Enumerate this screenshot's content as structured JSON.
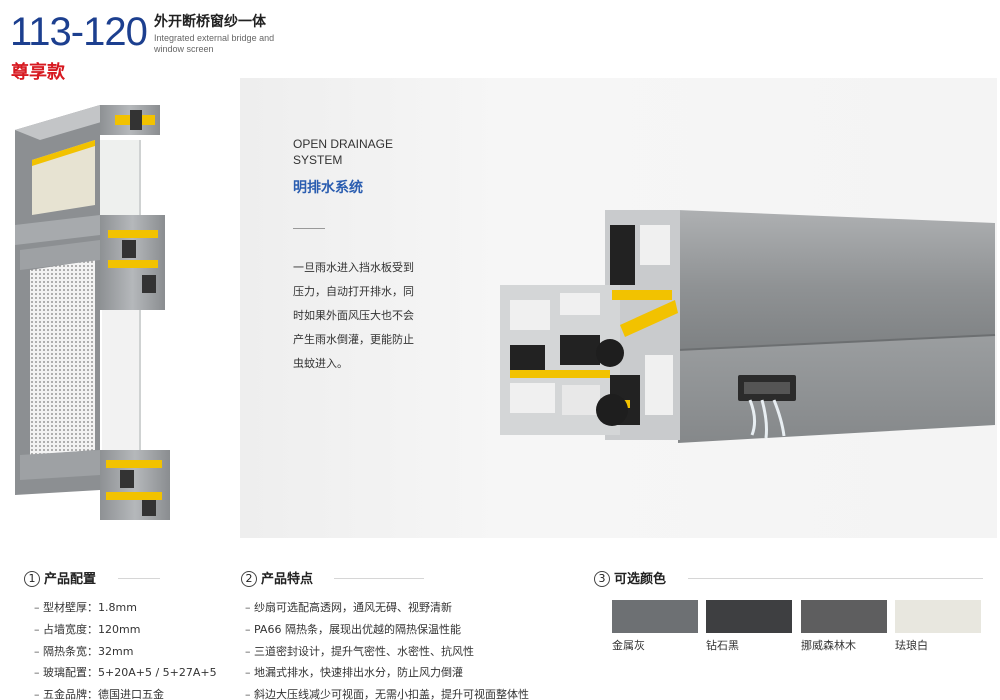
{
  "header": {
    "model": "113-120",
    "title_cn": "外开断桥窗纱一体",
    "title_en": "Integrated external bridge and window screen",
    "edition": "尊享款"
  },
  "feature": {
    "title_en_line1": "OPEN DRAINAGE",
    "title_en_line2": "SYSTEM",
    "title_cn": "明排水系统",
    "desc_lines": [
      "一旦雨水进入挡水板受到",
      "压力，自动打开排水，同",
      "时如果外面风压大也不会",
      "产生雨水倒灌，更能防止",
      "虫蚊进入。"
    ]
  },
  "sections": {
    "config": {
      "number": "1",
      "title": "产品配置",
      "items": [
        "型材壁厚：1.8mm",
        "占墙宽度：120mm",
        "隔热条宽：32mm",
        "玻璃配置：5+20A+5 / 5+27A+5",
        "五金品牌：德国进口五金"
      ]
    },
    "features": {
      "number": "2",
      "title": "产品特点",
      "items": [
        "纱扇可选配高透网，通风无碍、视野清新",
        "PA66 隔热条，展现出优越的隔热保温性能",
        "三道密封设计，提升气密性、水密性、抗风性",
        "地漏式排水，快速排出水分，防止风力倒灌",
        "斜边大压线减少可视面，无需小扣盖，提升可视面整体性"
      ]
    },
    "colors": {
      "number": "3",
      "title": "可选颜色",
      "swatches": [
        {
          "name": "金属灰",
          "color": "#6d7073"
        },
        {
          "name": "钻石黑",
          "color": "#3e3f41"
        },
        {
          "name": "挪威森林木",
          "color": "#5e5e5f"
        },
        {
          "name": "珐琅白",
          "color": "#e8e7df"
        }
      ]
    }
  },
  "colors": {
    "brand_blue": "#1c3f8f",
    "accent_red": "#d71920",
    "feature_blue": "#2a5db0",
    "profile_grey": "#9c9fa2",
    "strip_yellow": "#f2c200"
  }
}
